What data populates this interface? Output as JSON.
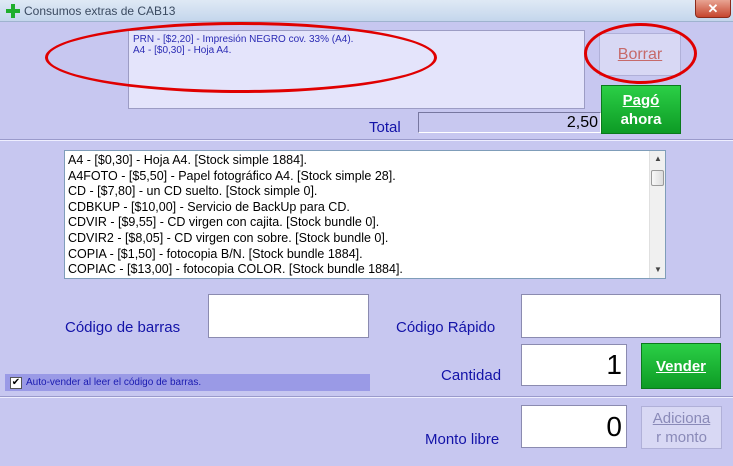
{
  "window": {
    "title": "Consumos extras de CAB13",
    "close_label": "✕"
  },
  "selected_items": [
    "PRN - [$2,20] - Impresión NEGRO cov. 33% (A4).",
    "A4 - [$0,30] - Hoja A4."
  ],
  "buttons": {
    "borrar": "Borrar",
    "pago_ahora_line1": "Pagó",
    "pago_ahora_line2": "ahora",
    "vender": "Vender",
    "adicionar_line1": "Adiciona",
    "adicionar_line2": "r monto"
  },
  "total": {
    "label": "Total",
    "value": "2,50"
  },
  "products": [
    "A4 - [$0,30] - Hoja A4. [Stock simple 1884].",
    "A4FOTO - [$5,50] - Papel fotográfico A4. [Stock simple 28].",
    "CD - [$7,80] - un CD suelto. [Stock simple 0].",
    "CDBKUP - [$10,00] - Servicio de BackUp para CD.",
    "CDVIR - [$9,55] - CD virgen con cajita. [Stock bundle 0].",
    "CDVIR2 - [$8,05] - CD virgen con sobre. [Stock bundle 0].",
    "COPIA - [$1,50] - fotocopia B/N. [Stock bundle 1884].",
    "COPIAC - [$13,00] - fotocopia COLOR. [Stock bundle 1884]."
  ],
  "fields": {
    "codigo_barras_label": "Código de barras",
    "codigo_barras_value": "",
    "codigo_rapido_label": "Código Rápido",
    "codigo_rapido_value": "",
    "cantidad_label": "Cantidad",
    "cantidad_value": "1",
    "monto_libre_label": "Monto libre",
    "monto_libre_value": "0"
  },
  "auto_vender": {
    "label": "Auto-vender al leer el código de barras.",
    "checked": true,
    "check_mark": "✔"
  },
  "colors": {
    "accent_green": "#1ab536",
    "annotation_red": "#e00000",
    "label_blue": "#1313a8"
  }
}
